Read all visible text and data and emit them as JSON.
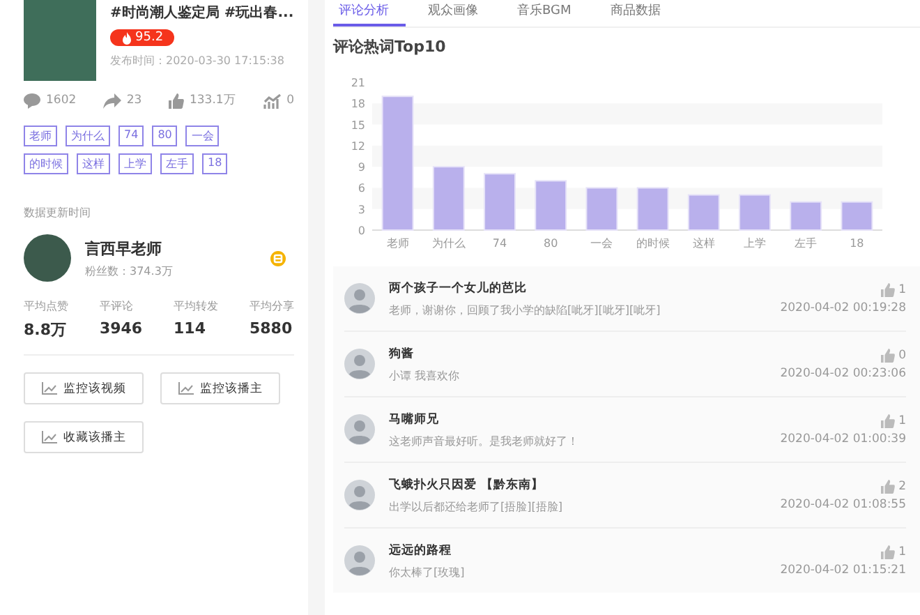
{
  "video": {
    "title": "#时尚潮人鉴定局 #玩出春...",
    "heat": "95.2",
    "publish_time": "发布时间：2020-03-30 17:15:38",
    "stats": [
      {
        "kind": "comment",
        "value": "1602"
      },
      {
        "kind": "share",
        "value": "23"
      },
      {
        "kind": "like",
        "value": "133.1万"
      },
      {
        "kind": "trend",
        "value": "0"
      }
    ],
    "tags": [
      "老师",
      "为什么",
      "74",
      "80",
      "一会",
      "的时候",
      "这样",
      "上学",
      "左手",
      "18"
    ]
  },
  "update_label": "数据更新时间",
  "author": {
    "name": "言西早老师",
    "fans": "粉丝数：374.3万"
  },
  "averages": [
    {
      "label": "平均点赞",
      "value": "8.8万"
    },
    {
      "label": "平评论",
      "value": "3946"
    },
    {
      "label": "平均转发",
      "value": "114"
    },
    {
      "label": "平均分享",
      "value": "5880"
    }
  ],
  "buttons": [
    "监控该视频",
    "监控该播主",
    "收藏该播主"
  ],
  "tabs": [
    {
      "label": "评论分析",
      "selected": true
    },
    {
      "label": "观众画像",
      "selected": false
    },
    {
      "label": "音乐BGM",
      "selected": false
    },
    {
      "label": "商品数据",
      "selected": false
    }
  ],
  "chart_title": "评论热词Top10",
  "chart_data": {
    "type": "bar",
    "categories": [
      "老师",
      "为什么",
      "74",
      "80",
      "一会",
      "的时候",
      "这样",
      "上学",
      "左手",
      "18"
    ],
    "series": [
      {
        "color": "#b9b0ec",
        "values": [
          19,
          9,
          8,
          7,
          6,
          6,
          5,
          5,
          4,
          4
        ]
      }
    ],
    "ylim": [
      0,
      21
    ],
    "yticks": [
      0,
      3,
      6,
      9,
      12,
      15,
      18,
      21
    ]
  },
  "comments": [
    {
      "name": "两个孩子一个女儿的芭比",
      "text": "老师，谢谢你，回顾了我小学的缺陷[呲牙][呲牙][呲牙]",
      "likes": "1",
      "time": "2020-04-02 00:19:28"
    },
    {
      "name": "狗酱",
      "text": "小谭 我喜欢你",
      "likes": "0",
      "time": "2020-04-02 00:23:06"
    },
    {
      "name": "马嘴师兄",
      "text": "这老师声音最好听。是我老师就好了！",
      "likes": "1",
      "time": "2020-04-02 01:00:39"
    },
    {
      "name": "飞蛾扑火只因爱 【黔东南】",
      "text": "出学以后都还给老师了[捂脸][捂脸]",
      "likes": "2",
      "time": "2020-04-02 01:08:55"
    },
    {
      "name": "远远的路程",
      "text": "你太棒了[玫瑰]",
      "likes": "1",
      "time": "2020-04-02 01:15:21"
    }
  ]
}
